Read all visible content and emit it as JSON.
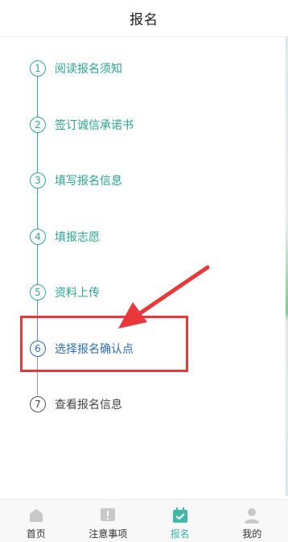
{
  "header": {
    "title": "报名"
  },
  "steps": [
    {
      "num": "1",
      "label": "阅读报名须知"
    },
    {
      "num": "2",
      "label": "签订诚信承诺书"
    },
    {
      "num": "3",
      "label": "填写报名信息"
    },
    {
      "num": "4",
      "label": "填报志愿"
    },
    {
      "num": "5",
      "label": "资料上传"
    },
    {
      "num": "6",
      "label": "选择报名确认点"
    },
    {
      "num": "7",
      "label": "查看报名信息"
    }
  ],
  "tabbar": {
    "items": [
      {
        "label": "首页",
        "icon": "home-icon"
      },
      {
        "label": "注意事项",
        "icon": "notice-icon"
      },
      {
        "label": "报名",
        "icon": "registration-icon"
      },
      {
        "label": "我的",
        "icon": "user-icon"
      }
    ],
    "active": "报名"
  },
  "colors": {
    "done": "#35a79b",
    "current": "#2b6cb8",
    "pending": "#444444",
    "annotation": "#e8383b",
    "tab_active": "#3fb8aa"
  }
}
